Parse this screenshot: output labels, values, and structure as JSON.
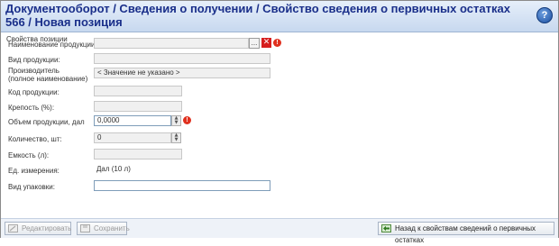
{
  "header": {
    "title": "Документооборот  / Сведения о получении / Свойство сведения о первичных остатках 566 / Новая позиция",
    "help_glyph": "?"
  },
  "section": {
    "title": "Свойства позиции"
  },
  "fields": {
    "product_name": {
      "label": "Наименование продукции:",
      "value": ""
    },
    "product_type": {
      "label": "Вид продукции:",
      "value": ""
    },
    "producer": {
      "label": "Производитель\n(полное наименование)",
      "value": "< Значение не указано >"
    },
    "product_code": {
      "label": "Код продукции:",
      "value": ""
    },
    "strength": {
      "label": "Крепость (%):",
      "value": ""
    },
    "volume": {
      "label": "Объем продукции, дал",
      "value": "0,0000"
    },
    "quantity": {
      "label": "Количество, шт:",
      "value": "0"
    },
    "capacity": {
      "label": "Емкость (л):",
      "value": ""
    },
    "unit": {
      "label": "Ед. измерения:",
      "value": "Дал (10 л)"
    },
    "packaging": {
      "label": "Вид упаковки:",
      "value": ""
    }
  },
  "controls": {
    "browse_label": "...",
    "clear_glyph": "✕",
    "warn_glyph": "!"
  },
  "footer": {
    "edit_label": "Редактировать",
    "save_label": "Сохранить",
    "back_label": "Назад к свойствам сведений о первичных остатках"
  },
  "colors": {
    "title": "#1a2f8a",
    "header_top": "#e6effa",
    "header_bottom": "#c7d8ef",
    "warning": "#e0301e"
  }
}
